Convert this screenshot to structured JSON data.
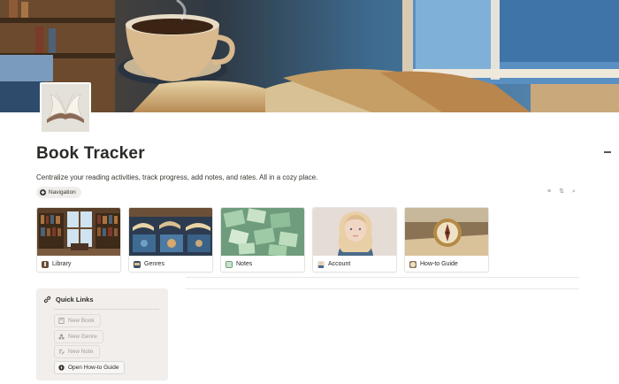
{
  "page": {
    "title": "Book Tracker",
    "description": "Centralize your reading activities, track progress, add notes, and rates. All in a cozy place."
  },
  "nav_tag": {
    "label": "Navigation"
  },
  "db_tools": [
    {
      "name": "filter-icon",
      "glyph": "≡"
    },
    {
      "name": "sort-icon",
      "glyph": "⇅"
    },
    {
      "name": "search-icon",
      "glyph": "⌕"
    }
  ],
  "cards": [
    {
      "label": "Library",
      "icon": "library-icon"
    },
    {
      "label": "Genres",
      "icon": "genres-icon"
    },
    {
      "label": "Notes",
      "icon": "notes-icon"
    },
    {
      "label": "Account",
      "icon": "account-icon"
    },
    {
      "label": "How-to Guide",
      "icon": "compass-icon"
    }
  ],
  "quick_links": {
    "title": "Quick Links",
    "buttons": [
      {
        "label": "New Book",
        "icon": "book-icon",
        "enabled": false
      },
      {
        "label": "New Genre",
        "icon": "genre-icon",
        "enabled": false
      },
      {
        "label": "New Note",
        "icon": "note-icon",
        "enabled": false
      },
      {
        "label": "Open How-to Guide",
        "icon": "compass-icon",
        "enabled": true
      }
    ]
  },
  "colors": {
    "title": "#2b2a27",
    "tag_bg": "#efeeec",
    "quick_bg": "#f1eeec"
  }
}
